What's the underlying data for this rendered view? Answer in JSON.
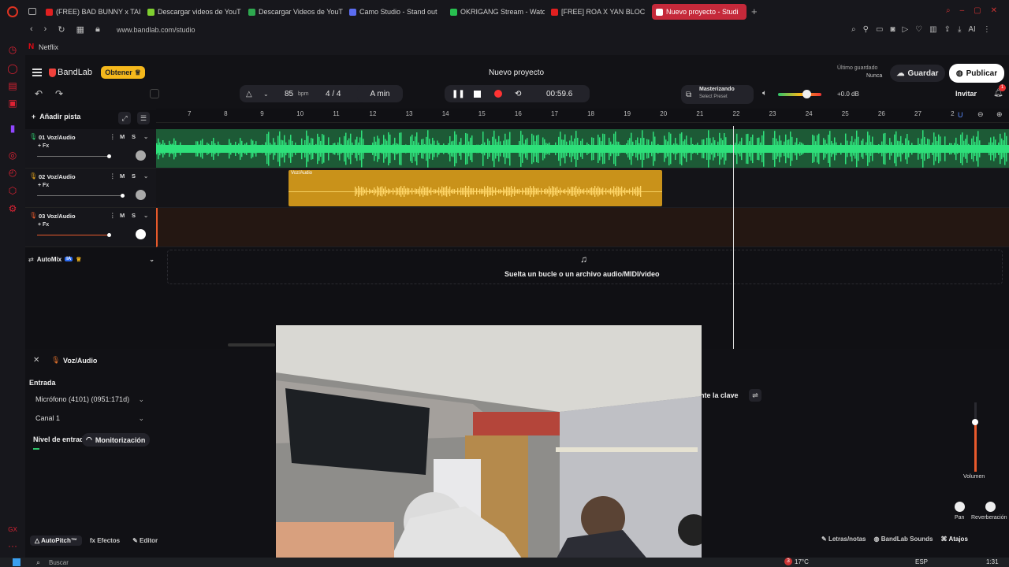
{
  "browser": {
    "url": "www.bandlab.com/studio",
    "bookmark": "Netflix",
    "tabs": [
      {
        "label": "(FREE) BAD BUNNY x TAIN",
        "color": "#e02020"
      },
      {
        "label": "Descargar videos de YouT",
        "color": "#7fcf30"
      },
      {
        "label": "Descargar Videos de YouT",
        "color": "#2ea84f"
      },
      {
        "label": "Camo Studio - Stand out",
        "color": "#5b6cf0"
      },
      {
        "label": "OKRIGANG Stream - Wato",
        "color": "#28c050"
      },
      {
        "label": "[FREE] ROA X YAN BLOCK",
        "color": "#e02020"
      },
      {
        "label": "Nuevo proyecto - Studi",
        "color": "#ffffff",
        "active": true
      }
    ]
  },
  "app": {
    "brand": "BandLab",
    "get_label": "Obtener",
    "project_title": "Nuevo proyecto",
    "last_saved_label": "Último guardado",
    "last_saved_value": "Nunca",
    "save_label": "Guardar",
    "publish_label": "Publicar",
    "invite_label": "Invitar",
    "notif_count": "1",
    "tempo": "85",
    "tempo_unit": "bpm",
    "time_sig": "4 / 4",
    "key": "A min",
    "time": "00:59.6",
    "mastering_title": "Masterizando",
    "mastering_preset": "Select Preset",
    "gain": "+0.0 dB",
    "add_track": "Añadir pista",
    "ruler_ticks": [
      "7",
      "8",
      "9",
      "10",
      "11",
      "12",
      "13",
      "14",
      "15",
      "16",
      "17",
      "18",
      "19",
      "20",
      "21",
      "22",
      "23",
      "24",
      "25",
      "26",
      "27",
      "2"
    ],
    "tracks": [
      {
        "num": "01",
        "name": "Voz/Audio",
        "fx": "+ Fx",
        "color": "#2ec46a"
      },
      {
        "num": "02",
        "name": "Voz/Audio",
        "fx": "+ Fx",
        "color": "#e0a11c"
      },
      {
        "num": "03",
        "name": "Voz/Audio",
        "fx": "+ Fx",
        "color": "#e85a2c"
      }
    ],
    "clip_label": "Voz/Audio",
    "automix": "AutoMix",
    "automix_badge": "IA",
    "drop_text": "Suelta un bucle o un archivo audio/MIDI/video"
  },
  "panel": {
    "track_name": "Voz/Audio",
    "input_label": "Entrada",
    "mic": "Micrófono (4101) (0951:171d)",
    "channel": "Canal 1",
    "level_label": "Nivel de entrada",
    "monitor_label": "Monitorización",
    "key_btn": "nte la clave",
    "volume_label": "Volumen",
    "pan_label": "Pan",
    "reverb_label": "Reverberación",
    "tabs": [
      "AutoPitch™",
      "Efectos",
      "Editor"
    ],
    "right_tabs": [
      "Letras/notas",
      "BandLab Sounds",
      "Atajos"
    ]
  },
  "taskbar": {
    "search": "Buscar",
    "temp": "17°C",
    "lang": "ESP",
    "clock": "1:31",
    "weather_badge": "3"
  }
}
